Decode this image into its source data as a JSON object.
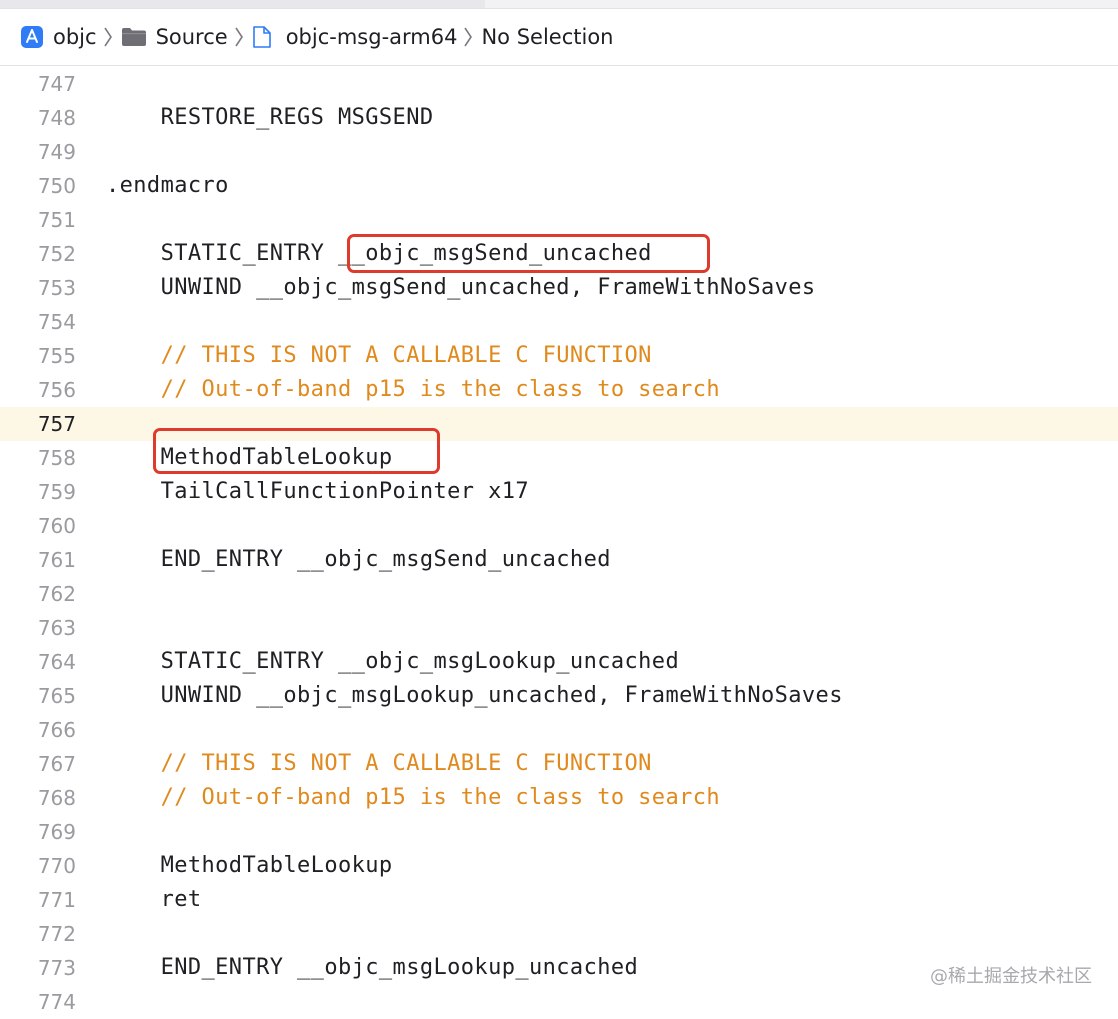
{
  "breadcrumb": {
    "items": [
      {
        "label": "objc",
        "icon": "app-project-icon"
      },
      {
        "label": "Source",
        "icon": "folder-icon"
      },
      {
        "label": "objc-msg-arm64",
        "icon": "file-icon"
      },
      {
        "label": "No Selection",
        "icon": ""
      }
    ]
  },
  "editor": {
    "current_line": "757",
    "lines": [
      {
        "num": "747",
        "text": "",
        "kind": "code"
      },
      {
        "num": "748",
        "text": "    RESTORE_REGS MSGSEND",
        "kind": "code"
      },
      {
        "num": "749",
        "text": "",
        "kind": "code"
      },
      {
        "num": "750",
        "text": ".endmacro",
        "kind": "code"
      },
      {
        "num": "751",
        "text": "",
        "kind": "code"
      },
      {
        "num": "752",
        "text": "    STATIC_ENTRY __objc_msgSend_uncached",
        "kind": "code"
      },
      {
        "num": "753",
        "text": "    UNWIND __objc_msgSend_uncached, FrameWithNoSaves",
        "kind": "code"
      },
      {
        "num": "754",
        "text": "",
        "kind": "code"
      },
      {
        "num": "755",
        "text": "    // THIS IS NOT A CALLABLE C FUNCTION",
        "kind": "comment"
      },
      {
        "num": "756",
        "text": "    // Out-of-band p15 is the class to search",
        "kind": "comment"
      },
      {
        "num": "757",
        "text": "",
        "kind": "code"
      },
      {
        "num": "758",
        "text": "    MethodTableLookup",
        "kind": "code"
      },
      {
        "num": "759",
        "text": "    TailCallFunctionPointer x17",
        "kind": "code"
      },
      {
        "num": "760",
        "text": "",
        "kind": "code"
      },
      {
        "num": "761",
        "text": "    END_ENTRY __objc_msgSend_uncached",
        "kind": "code"
      },
      {
        "num": "762",
        "text": "",
        "kind": "code"
      },
      {
        "num": "763",
        "text": "",
        "kind": "code"
      },
      {
        "num": "764",
        "text": "    STATIC_ENTRY __objc_msgLookup_uncached",
        "kind": "code"
      },
      {
        "num": "765",
        "text": "    UNWIND __objc_msgLookup_uncached, FrameWithNoSaves",
        "kind": "code"
      },
      {
        "num": "766",
        "text": "",
        "kind": "code"
      },
      {
        "num": "767",
        "text": "    // THIS IS NOT A CALLABLE C FUNCTION",
        "kind": "comment"
      },
      {
        "num": "768",
        "text": "    // Out-of-band p15 is the class to search",
        "kind": "comment"
      },
      {
        "num": "769",
        "text": "",
        "kind": "code"
      },
      {
        "num": "770",
        "text": "    MethodTableLookup",
        "kind": "code"
      },
      {
        "num": "771",
        "text": "    ret",
        "kind": "code"
      },
      {
        "num": "772",
        "text": "",
        "kind": "code"
      },
      {
        "num": "773",
        "text": "    END_ENTRY __objc_msgLookup_uncached",
        "kind": "code"
      },
      {
        "num": "774",
        "text": "",
        "kind": "code"
      }
    ]
  },
  "colors": {
    "comment": "#e08a1e",
    "highlight_box": "#dd3b2c",
    "current_line_bg": "#fdf7e6"
  },
  "watermark": "@稀土掘金技术社区"
}
